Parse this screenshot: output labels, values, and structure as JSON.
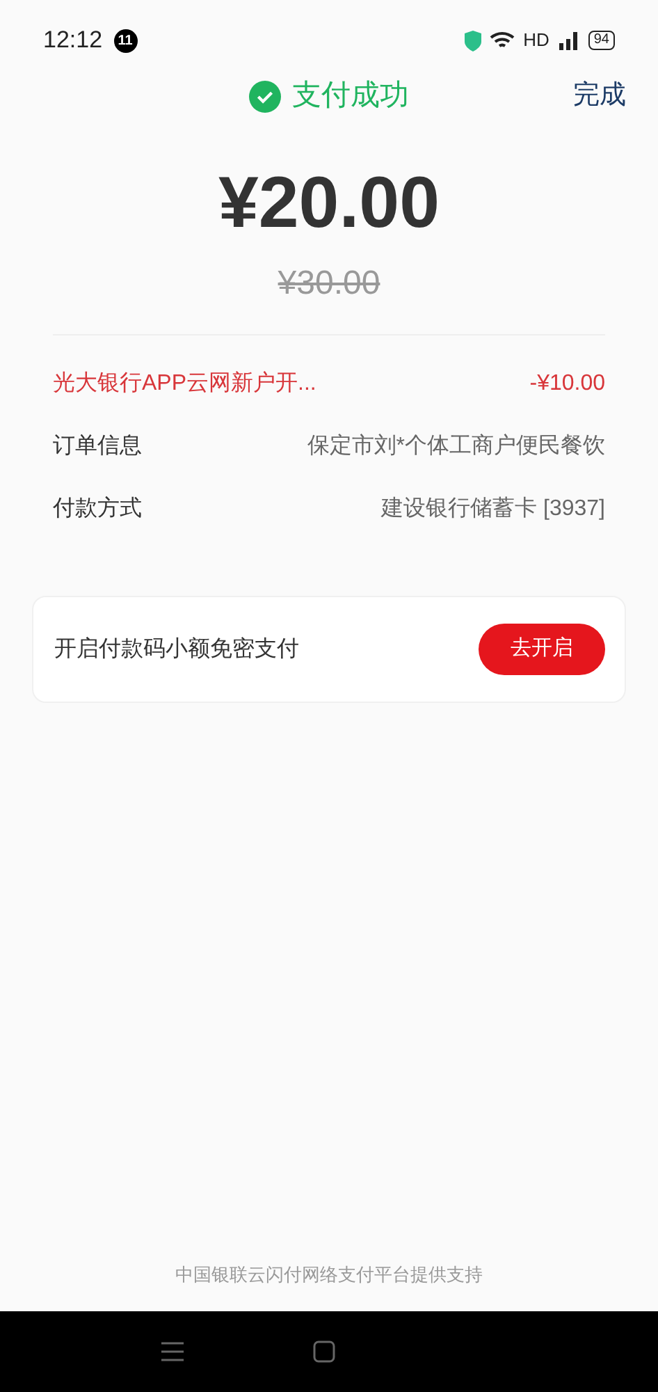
{
  "status_bar": {
    "time": "12:12",
    "notification_count": "11",
    "network": "HD",
    "battery": "94"
  },
  "header": {
    "title": "支付成功",
    "done": "完成"
  },
  "amount": {
    "paid": "¥20.00",
    "original": "¥30.00"
  },
  "discount": {
    "label": "光大银行APP云网新户开...",
    "value": "-¥10.00"
  },
  "details": [
    {
      "label": "订单信息",
      "value": "保定市刘*个体工商户便民餐饮"
    },
    {
      "label": "付款方式",
      "value": "建设银行储蓄卡 [3937]"
    }
  ],
  "promo": {
    "text": "开启付款码小额免密支付",
    "button": "去开启"
  },
  "footer": "中国银联云闪付网络支付平台提供支持"
}
